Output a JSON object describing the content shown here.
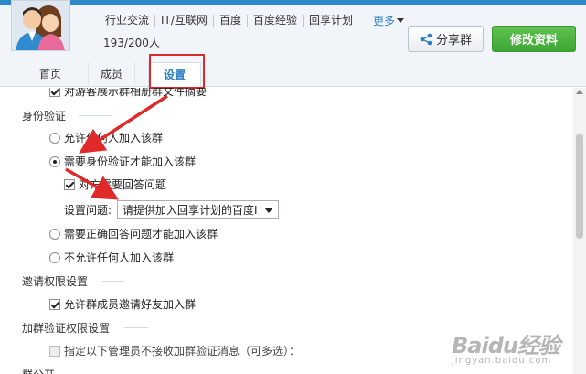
{
  "header": {
    "tags": [
      "行业交流",
      "IT/互联网",
      "百度",
      "百度经验",
      "回享计划"
    ],
    "more_label": "更多",
    "member_count": "193/200人",
    "share_label": "分享群",
    "edit_label": "修改资料"
  },
  "tabs": {
    "home": "首页",
    "members": "成员",
    "settings": "设置"
  },
  "content": {
    "partial_top": "对游客展示群相册群文件摘要",
    "auth_section": "身份验证",
    "options": {
      "allow_anyone": "允许任何人加入该群",
      "require_auth": "需要身份验证才能加入该群",
      "answer_question": "对方需要回答问题",
      "question_label": "设置问题:",
      "question_value": "请提供加入回享计划的百度I",
      "require_correct": "需要正确回答问题才能加入该群",
      "disallow": "不允许任何人加入该群"
    },
    "invite_section": "邀请权限设置",
    "invite_option": "允许群成员邀请好友加入群",
    "verify_section": "加群验证权限设置",
    "verify_option": "指定以下管理员不接收加群验证消息（可多选）：",
    "partial_bottom": "群公开"
  },
  "watermark": {
    "main": "Baidu经验",
    "sub": "jingyan.baidu.com"
  },
  "colors": {
    "accent_blue": "#2d7fc1",
    "green_button": "#3da733",
    "annotation_red": "#d92b2b"
  }
}
